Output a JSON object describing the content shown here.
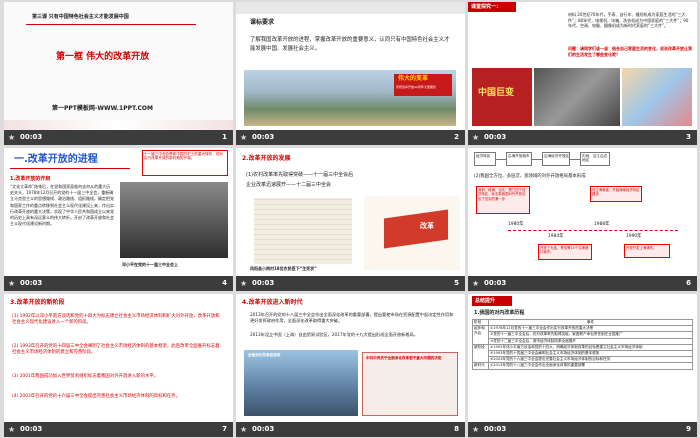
{
  "footer": {
    "time": "00:03",
    "slide_numbers": [
      "1",
      "2",
      "3",
      "4",
      "5",
      "6",
      "7",
      "8",
      "9"
    ]
  },
  "slide1": {
    "lesson": "第三课  只有中国特色社会主义才能发展中国",
    "title": "第一框  伟大的改革开放",
    "brand": "第一PPT模板网-WWW.1PPT.COM"
  },
  "slide2": {
    "heading": "课标要求",
    "body": "了解我国改革开放的进程，掌握改革开放的重要意义，认同只有中国特色社会主义才能发展中国、发展社会主义。",
    "banner": "伟大的变革",
    "banner_sub": "庆祝改革开放40周年大型展览"
  },
  "slide3": {
    "tag": "课堂探究一：",
    "material": "材料  20世纪70年代，手表、自行车、缝纫机成为家庭生活的“三大件”；80年代，电视机、冰箱、洗衣机成为中国家庭的“三大件”；90年代，空调、电脑、摄像机成为新时代家庭的“三大件”。",
    "question": "问题：请同学们谈一谈：结合自己家庭生活的变化，说说改革开放让我们的生活发生了哪些变化呢？",
    "photo_text": "中国巨变"
  },
  "slide4": {
    "title": "一.改革开放的进程",
    "sub": "1.改革开放的开启",
    "body": "“文化大革命”结束后，在党和国家面临何去何从的重大历史关头，1978年12月召开的党的十一届三中全会，重新确立马克思主义的思想路线、政治路线、组织路线，确定把党和国家工作的重点转移到社会主义现代化建设上来，作出实行改革开放的重大决策，实现了中华人民共和国成立以来党的历史上具有深远意义的伟大转折，开启了改革开放和社会主义现代化建设新时期。",
    "note": "十一届三中全会是新中国历史上的重大转折，成为实行改革开放的新时期的开端。",
    "caption": "邓小平在党的十一届三中全会上"
  },
  "slide5": {
    "title": "2.改革开放的发展",
    "l1": "(1)农村改革率先取得突破——十一届三中全会后",
    "l2": "企业改革迅速展开——十二届三中全会",
    "caption": "凤阳县小岗村18位农民签下“生死状”",
    "sign": "改革"
  },
  "slide6": {
    "flow": [
      "经济特区",
      "沿海开放城市",
      "沿海经济开放区",
      "内地，沿江沿边地区"
    ],
    "l1": "(2)我国全方位、多层次、宽领域的对外开放格局基本形成",
    "box1": "深圳、珠海、汕头、厦门四个经济特区，标志着我国对外开放迈出了坚实的第一步",
    "box2": "设立海南省，开始海南经济特区建设",
    "years": [
      "1980年",
      "1984年",
      "1988年",
      "1990年"
    ],
    "lab1984": "开放了大连、青岛等14个沿海港口城市。",
    "lab1990": "开放开发上海浦东。"
  },
  "slide7": {
    "title": "3.改革开放的新阶段",
    "p1": "(1) 1992年以邓小平南方谈话和党的十四大为标志建立社会主义市场经济体制和扩大对外开放，改革开放和社会主义现代化建设进入一个新的阶段。",
    "p2": "(2) 1993年召开的党的十四届三中全会阐明了社会主义市场经济体制的基本框架，此后改革全面展开标志着社会主义市场经济体制的建立和完善阶段。",
    "p3": "(3) 2001年我国成功加入世界贸易组织标志着我国对外开放进入新的水平。",
    "p4": "(4) 2003年召开的党的十六届三中全会提出完善社会主义市场经济体制的目标和任务。"
  },
  "slide8": {
    "title": "4.改革开放进入新时代",
    "p1": "2013年召开的党的十八届三中全会作出全面深化改革的重要部署，提出要使市场在资源配置中起决定性作用和更好发挥政府作用，全面深化改革取得重大突破。",
    "p2": "2013年设立中国（上海）自由贸易试验区，2017年党的十九大提出形成全面开放新格局。",
    "pic_text": "全面深化改革总目标",
    "news": "中共中央关于全面深化改革若干重大问题的决定"
  },
  "slide9": {
    "title": "总结提升",
    "sub": "1.我国的对内改革历程",
    "headers": [
      "阶段",
      "事件"
    ],
    "stages": [
      "起步和开启",
      "新阶段",
      "新时代"
    ],
    "rows": [
      "①1978年12月党的十一届三中全会作出实行改革开放的重大决策",
      "②党的十一届三中全会后，农村改革率先取得突破，家庭联产承包责任制在全国推广",
      "③党的十二届三中全会后，城市经济体制改革全面展开",
      "④1992年邓小平南方谈话和党的十四大，明确经济体制改革的目标是建立社会主义市场经济体制",
      "⑤1993年党的十四届三中全会阐明社会主义市场经济体制的基本框架",
      "⑥2003年党的十六届三中全会提出完善社会主义市场经济体制的目标和任务",
      "⑦2013年党的十八届三中全会作出全面深化改革的重要部署"
    ]
  }
}
